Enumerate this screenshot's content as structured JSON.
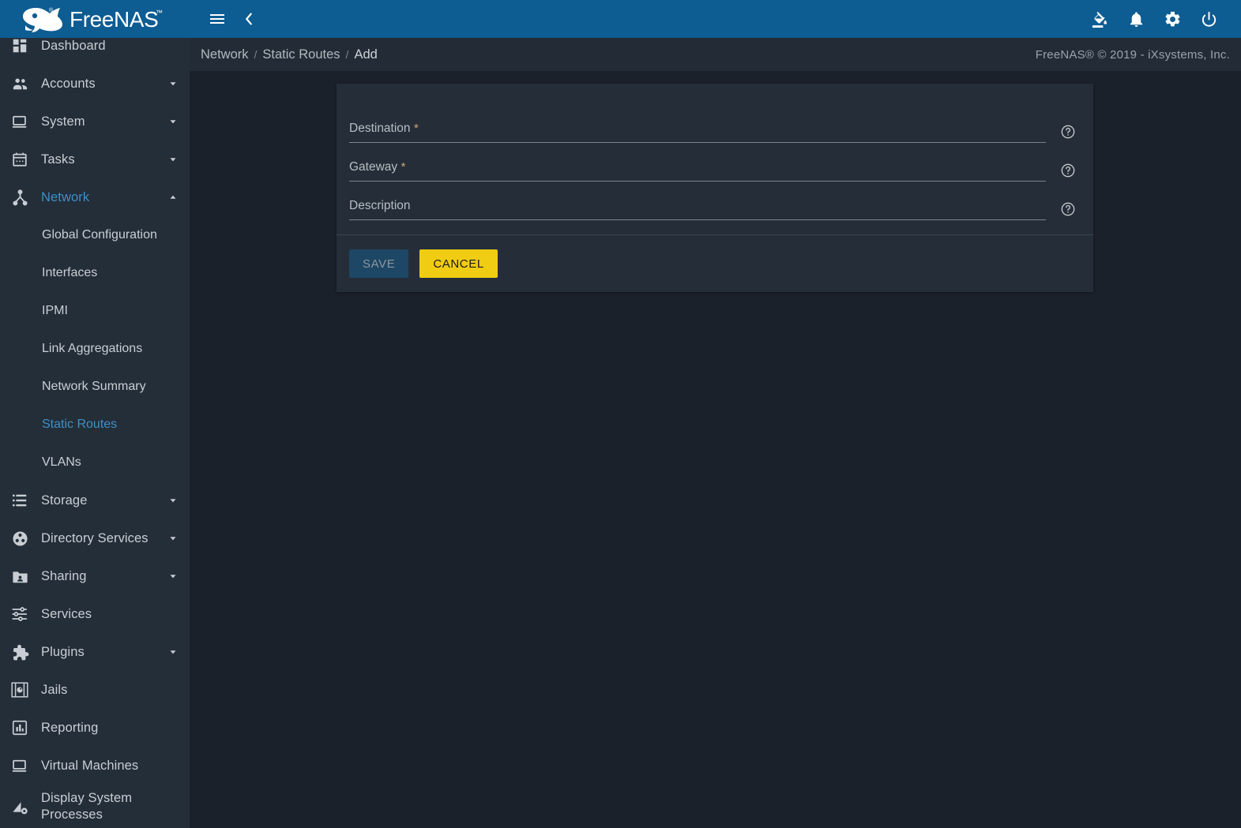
{
  "app": {
    "brand": "FreeNAS",
    "brand_tm": "™",
    "accent_blue": "#0d5c92",
    "active_link_color": "#3f8fc4",
    "sidebar_bg": "#242e39",
    "content_bg": "#1a212a",
    "card_bg": "#252e38",
    "cancel_yellow": "#f0cc13"
  },
  "topbar": {
    "menu_toggle": "menu-icon",
    "collapse_toggle": "chevron-left-icon",
    "right_icons": [
      {
        "name": "theme-fill-icon",
        "label": "Change Theme"
      },
      {
        "name": "bell-icon",
        "label": "Notifications"
      },
      {
        "name": "gear-icon",
        "label": "Settings"
      },
      {
        "name": "power-icon",
        "label": "Power"
      }
    ]
  },
  "breadcrumb": {
    "items": [
      "Network",
      "Static Routes",
      "Add"
    ],
    "separator": "/",
    "copyright": "FreeNAS® © 2019 - iXsystems, Inc."
  },
  "sidebar": {
    "items": [
      {
        "label": "Dashboard",
        "icon": "dashboard-icon",
        "expandable": false,
        "active": false
      },
      {
        "label": "Accounts",
        "icon": "accounts-icon",
        "expandable": true,
        "expanded": false,
        "active": false
      },
      {
        "label": "System",
        "icon": "system-icon",
        "expandable": true,
        "expanded": false,
        "active": false
      },
      {
        "label": "Tasks",
        "icon": "tasks-icon",
        "expandable": true,
        "expanded": false,
        "active": false
      },
      {
        "label": "Network",
        "icon": "network-icon",
        "expandable": true,
        "expanded": true,
        "active": true
      },
      {
        "label": "Storage",
        "icon": "storage-icon",
        "expandable": true,
        "expanded": false,
        "active": false
      },
      {
        "label": "Directory Services",
        "icon": "directory-services-icon",
        "expandable": true,
        "expanded": false,
        "active": false
      },
      {
        "label": "Sharing",
        "icon": "sharing-icon",
        "expandable": true,
        "expanded": false,
        "active": false
      },
      {
        "label": "Services",
        "icon": "services-icon",
        "expandable": false,
        "active": false
      },
      {
        "label": "Plugins",
        "icon": "plugins-icon",
        "expandable": true,
        "expanded": false,
        "active": false
      },
      {
        "label": "Jails",
        "icon": "jails-icon",
        "expandable": false,
        "active": false
      },
      {
        "label": "Reporting",
        "icon": "reporting-icon",
        "expandable": false,
        "active": false
      },
      {
        "label": "Virtual Machines",
        "icon": "virtual-machines-icon",
        "expandable": false,
        "active": false
      },
      {
        "label": "Display System Processes",
        "icon": "display-system-processes-icon",
        "expandable": false,
        "active": false
      }
    ],
    "network_children": [
      {
        "label": "Global Configuration",
        "active": false
      },
      {
        "label": "Interfaces",
        "active": false
      },
      {
        "label": "IPMI",
        "active": false
      },
      {
        "label": "Link Aggregations",
        "active": false
      },
      {
        "label": "Network Summary",
        "active": false
      },
      {
        "label": "Static Routes",
        "active": true
      },
      {
        "label": "VLANs",
        "active": false
      }
    ]
  },
  "form": {
    "fields": [
      {
        "label": "Destination",
        "required": true,
        "required_mark": "*",
        "value": "",
        "placeholder": "",
        "help": "help-icon"
      },
      {
        "label": "Gateway",
        "required": true,
        "required_mark": "*",
        "value": "",
        "placeholder": "",
        "help": "help-icon"
      },
      {
        "label": "Description",
        "required": false,
        "required_mark": "",
        "value": "",
        "placeholder": "",
        "help": "help-icon"
      }
    ],
    "save_label": "SAVE",
    "save_disabled": true,
    "cancel_label": "CANCEL"
  }
}
